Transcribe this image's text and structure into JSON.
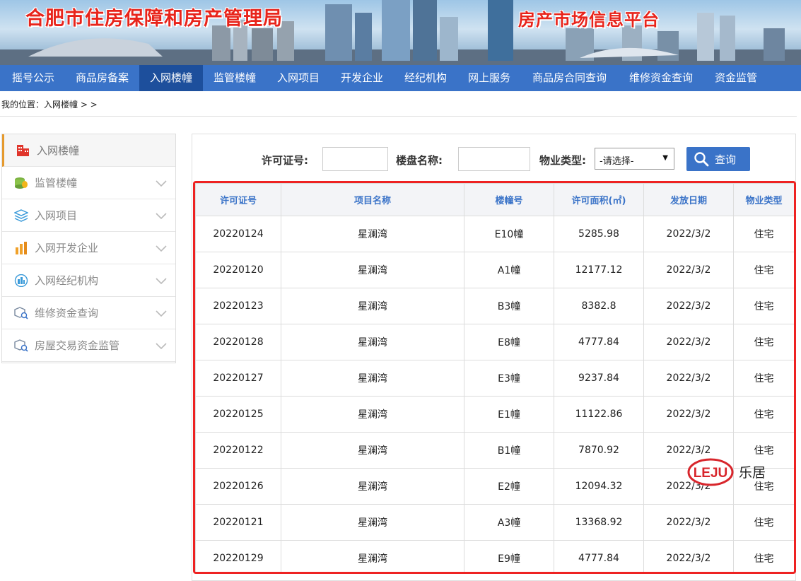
{
  "banner": {
    "title": "合肥市住房保障和房产管理局",
    "subtitle": "房产市场信息平台"
  },
  "nav": [
    {
      "label": "摇号公示",
      "active": false
    },
    {
      "label": "商品房备案",
      "active": false
    },
    {
      "label": "入网楼幢",
      "active": true
    },
    {
      "label": "监管楼幢",
      "active": false
    },
    {
      "label": "入网项目",
      "active": false
    },
    {
      "label": "开发企业",
      "active": false
    },
    {
      "label": "经纪机构",
      "active": false
    },
    {
      "label": "网上服务",
      "active": false
    },
    {
      "label": "商品房合同查询",
      "active": false
    },
    {
      "label": "维修资金查询",
      "active": false
    },
    {
      "label": "资金监管",
      "active": false
    }
  ],
  "breadcrumb": "我的位置：入网楼幢 > >",
  "sidebar": {
    "items": [
      {
        "label": "入网楼幢",
        "icon": "building-icon",
        "active": true
      },
      {
        "label": "监管楼幢",
        "icon": "coins-icon",
        "active": false
      },
      {
        "label": "入网项目",
        "icon": "layers-icon",
        "active": false
      },
      {
        "label": "入网开发企业",
        "icon": "bar-chart-icon",
        "active": false
      },
      {
        "label": "入网经纪机构",
        "icon": "city-circle-icon",
        "active": false
      },
      {
        "label": "维修资金查询",
        "icon": "cube-search-icon",
        "active": false
      },
      {
        "label": "房屋交易资金监管",
        "icon": "cube-search-icon",
        "active": false
      }
    ]
  },
  "search": {
    "permit_label": "许可证号:",
    "permit_value": "",
    "name_label": "楼盘名称:",
    "name_value": "",
    "type_label": "物业类型:",
    "type_selected": "-请选择-",
    "button_label": "查询"
  },
  "table": {
    "headers": [
      "许可证号",
      "项目名称",
      "楼幢号",
      "许可面积(㎡)",
      "发放日期",
      "物业类型"
    ],
    "rows": [
      [
        "20220124",
        "星澜湾",
        "E10幢",
        "5285.98",
        "2022/3/2",
        "住宅"
      ],
      [
        "20220120",
        "星澜湾",
        "A1幢",
        "12177.12",
        "2022/3/2",
        "住宅"
      ],
      [
        "20220123",
        "星澜湾",
        "B3幢",
        "8382.8",
        "2022/3/2",
        "住宅"
      ],
      [
        "20220128",
        "星澜湾",
        "E8幢",
        "4777.84",
        "2022/3/2",
        "住宅"
      ],
      [
        "20220127",
        "星澜湾",
        "E3幢",
        "9237.84",
        "2022/3/2",
        "住宅"
      ],
      [
        "20220125",
        "星澜湾",
        "E1幢",
        "11122.86",
        "2022/3/2",
        "住宅"
      ],
      [
        "20220122",
        "星澜湾",
        "B1幢",
        "7870.92",
        "2022/3/2",
        "住宅"
      ],
      [
        "20220126",
        "星澜湾",
        "E2幢",
        "12094.32",
        "2022/3/2",
        "住宅"
      ],
      [
        "20220121",
        "星澜湾",
        "A3幢",
        "13368.92",
        "2022/3/2",
        "住宅"
      ],
      [
        "20220129",
        "星澜湾",
        "E9幢",
        "4777.84",
        "2022/3/2",
        "住宅"
      ]
    ]
  },
  "watermark": {
    "logo_text": "LEJU",
    "text": "乐居"
  },
  "colors": {
    "nav_bg": "#3a73c8",
    "nav_active": "#1d4f9c",
    "title_red": "#e8241b",
    "highlight_border": "#ee2222",
    "sidebar_accent": "#e59a2e"
  }
}
